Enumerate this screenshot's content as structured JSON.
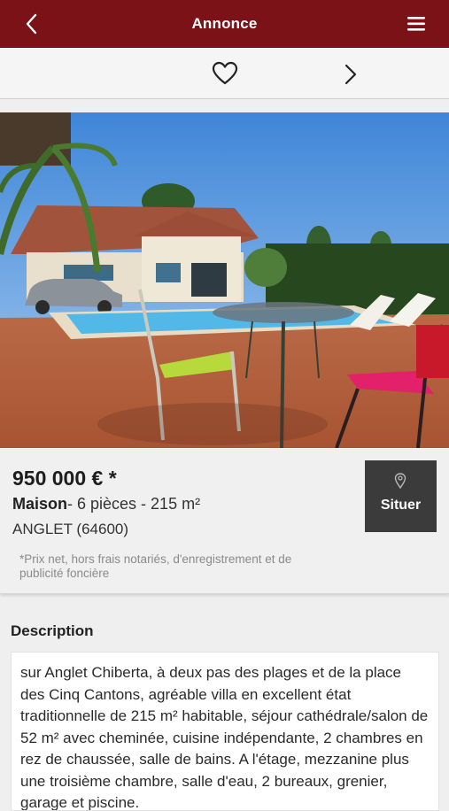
{
  "header": {
    "title": "Annonce",
    "back_icon": "chevron-left-icon",
    "menu_icon": "hamburger-menu-icon",
    "color": "#7a1217"
  },
  "actions": {
    "favorite_icon": "heart-outline-icon",
    "next_icon": "chevron-right-icon"
  },
  "listing": {
    "price": "950 000 € *",
    "type": "Maison",
    "details": "- 6 pièces - 215 m²",
    "city": "ANGLET (64600)",
    "price_note": "*Prix net, hors frais notariés, d'enregistrement et de publicité foncière",
    "locate_label": "Situer",
    "locate_icon": "map-pin-icon"
  },
  "description": {
    "title": "Description",
    "text": "sur Anglet Chiberta, à deux pas des plages et de la place des Cinq Cantons, agréable villa en excellent état traditionnelle de 215 m² habitable, séjour cathédrale/salon de 52 m² avec cheminée, cuisine indépendante, 2 chambres en rez de chaussée, salle de bains. A l'étage, mezzanine plus une troisième chambre, salle d'eau, 2 bureaux, grenier, garage et piscine."
  }
}
